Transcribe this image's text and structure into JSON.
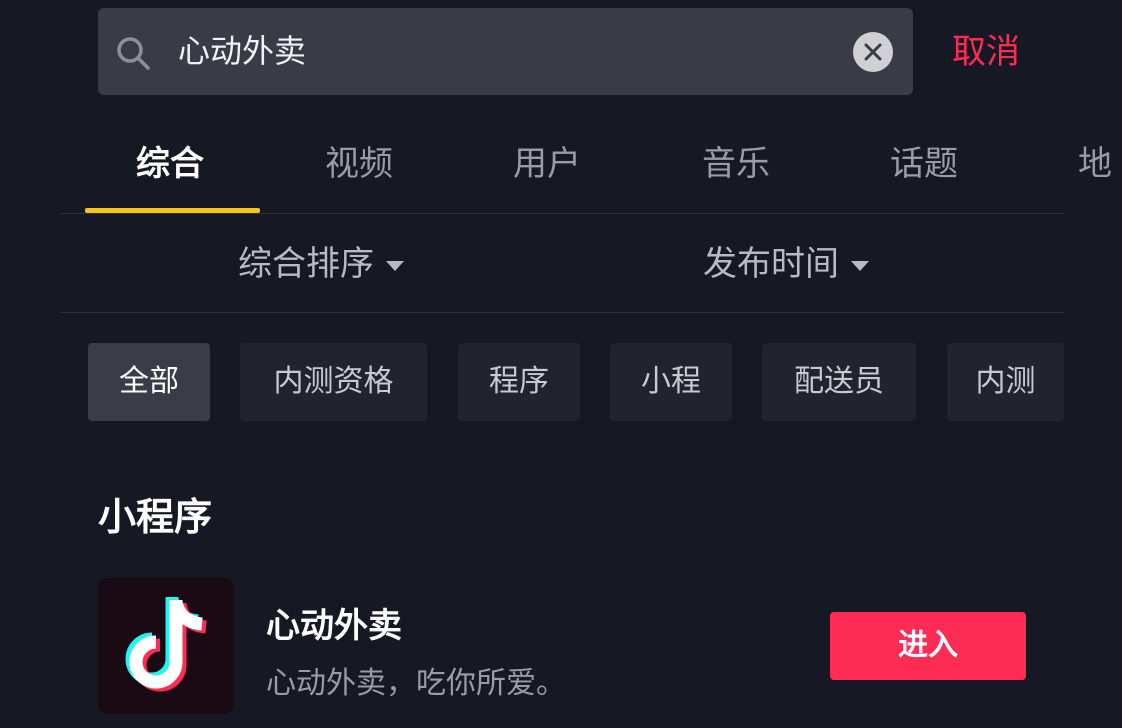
{
  "search": {
    "query": "心动外卖",
    "cancel_label": "取消"
  },
  "tabs": [
    {
      "label": "综合",
      "active": true
    },
    {
      "label": "视频"
    },
    {
      "label": "用户"
    },
    {
      "label": "音乐"
    },
    {
      "label": "话题"
    },
    {
      "label": "地"
    }
  ],
  "sort": {
    "order_label": "综合排序",
    "time_label": "发布时间"
  },
  "chips": [
    "全部",
    "内测资格",
    "程序",
    "小程",
    "配送员",
    "内测"
  ],
  "section": {
    "title": "小程序"
  },
  "mini_program": {
    "name": "心动外卖",
    "description": "心动外卖，吃你所爱。",
    "enter_label": "进入",
    "icon": "tiktok-logo-icon"
  },
  "colors": {
    "background": "#161823",
    "accent": "#fe2c55",
    "tab_indicator": "#f5c518"
  }
}
